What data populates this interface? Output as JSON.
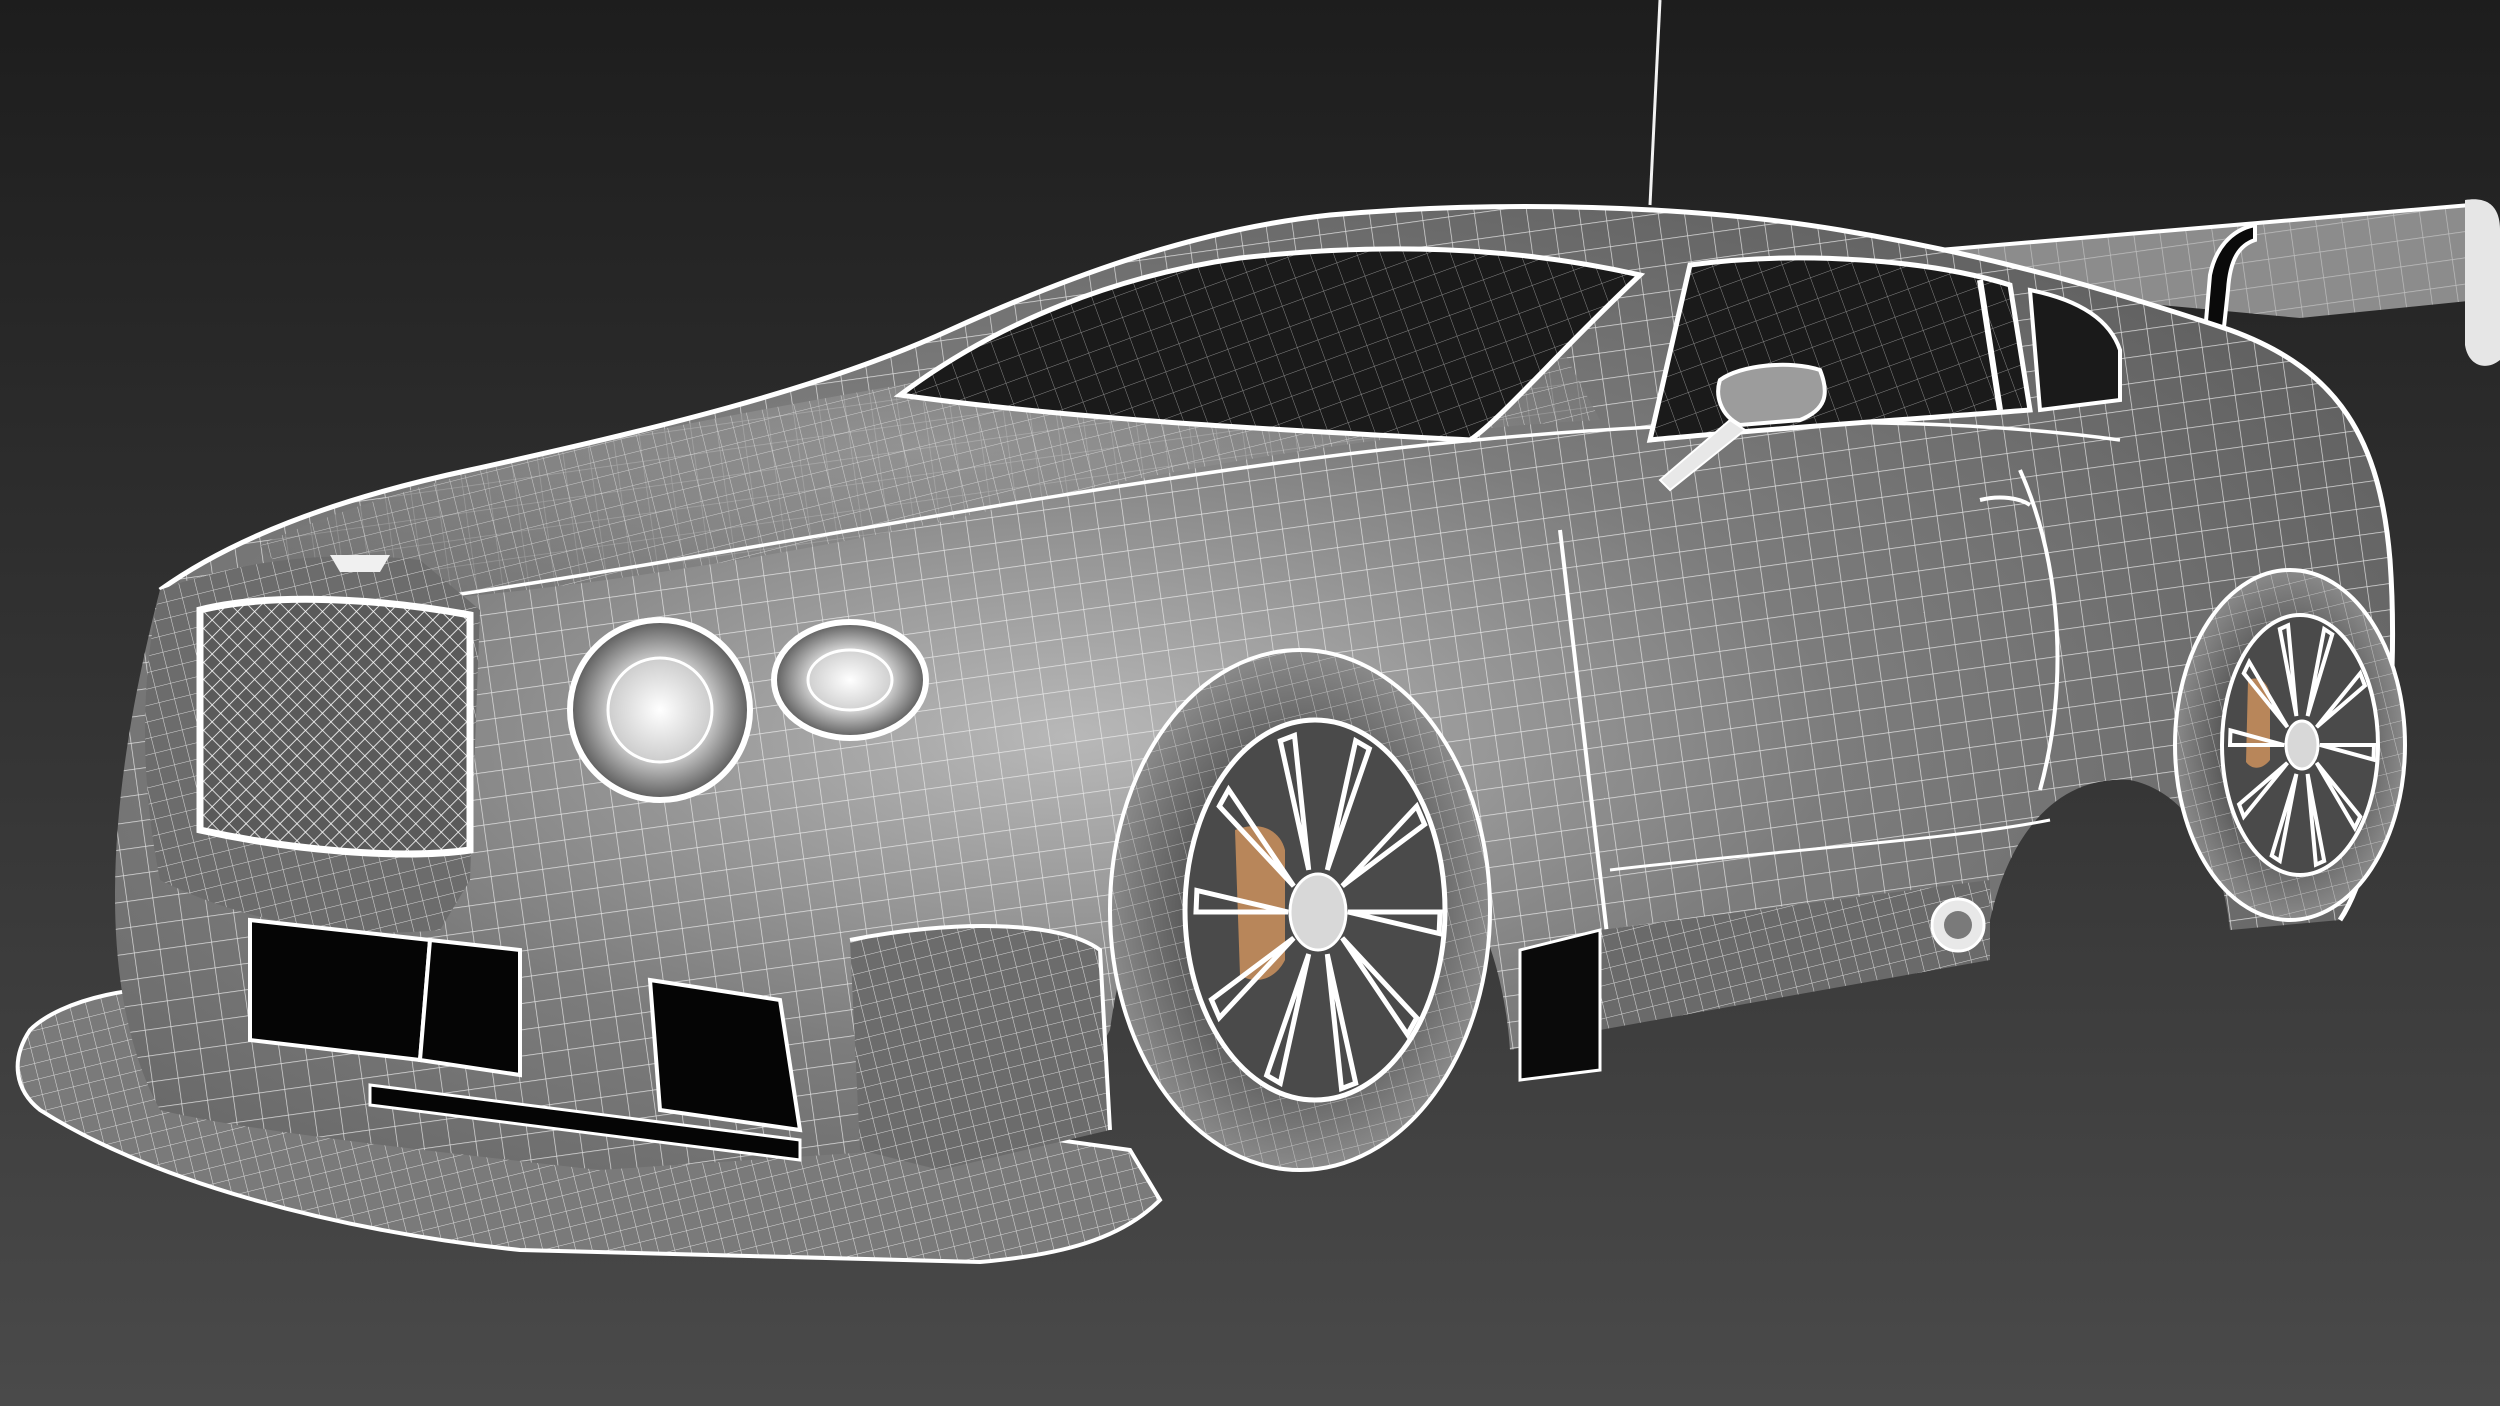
{
  "scene": {
    "subject": "sports-car-wireframe",
    "icon": "car-wireframe-icon",
    "colors": {
      "background_top": "#1d1d1d",
      "background_bottom": "#4a4a4a",
      "body_shade": "#6f6f6f",
      "body_highlight": "#b8b8b8",
      "wire": "#f2f2f2",
      "wire_dim": "#d0d0d0",
      "opening": "#050505",
      "glass": "#1a1a1a",
      "brake": "#b8865a"
    }
  }
}
